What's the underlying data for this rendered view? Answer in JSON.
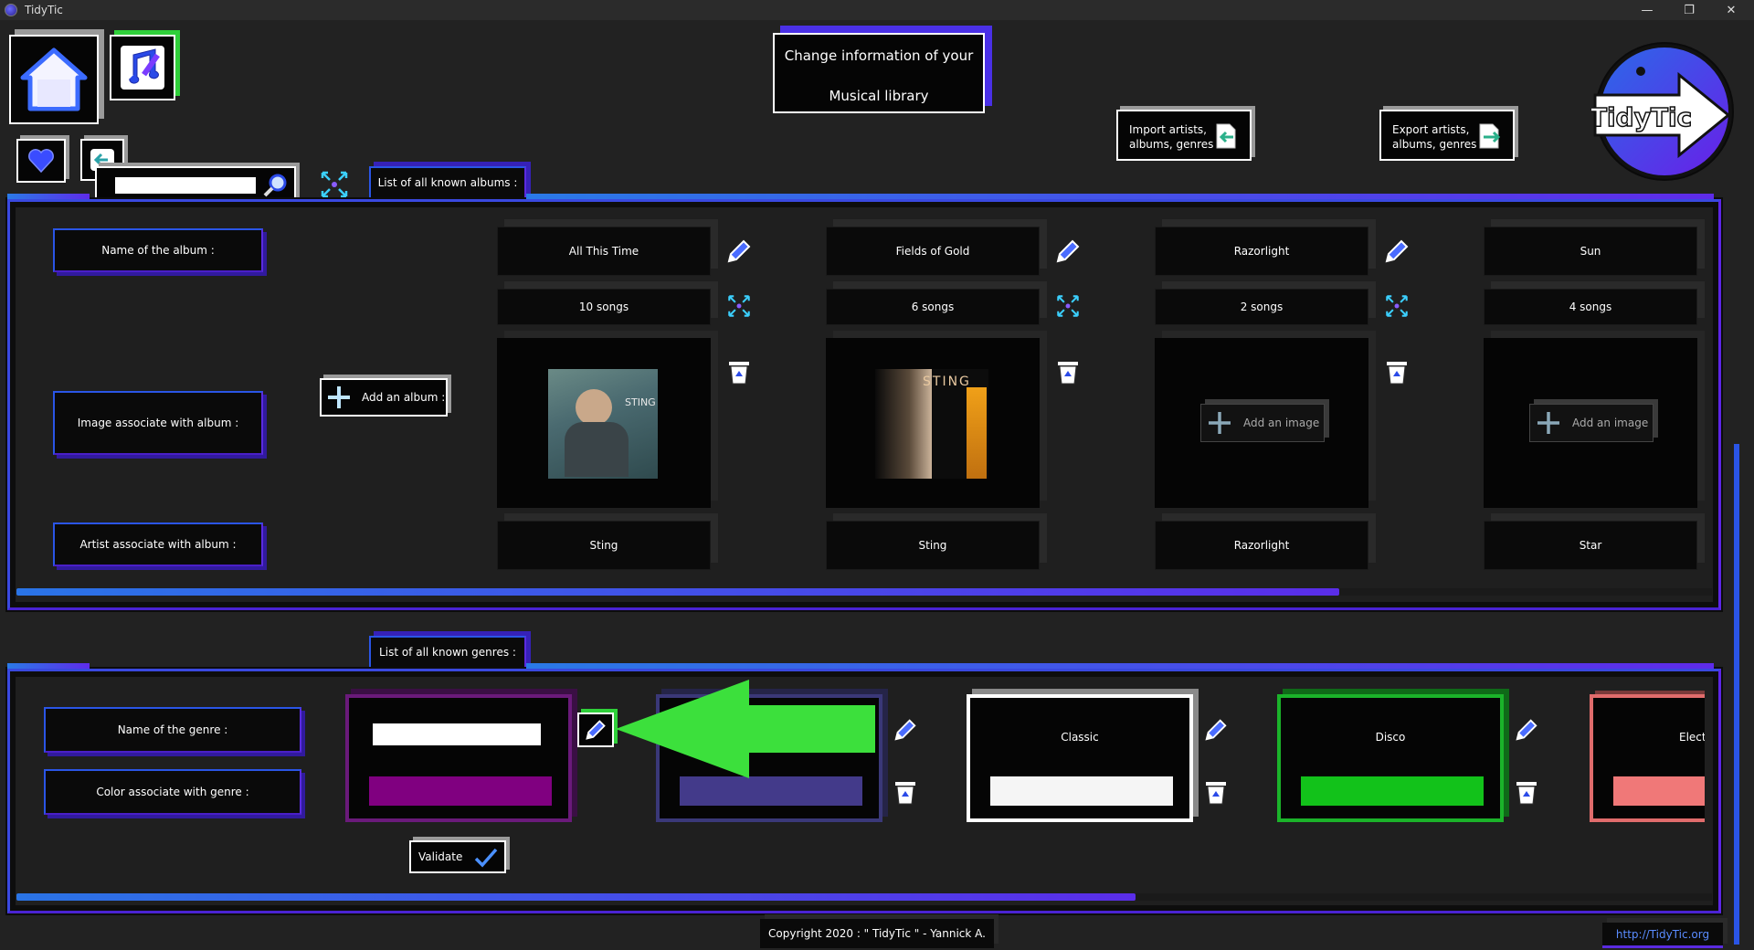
{
  "window": {
    "title": "TidyTic",
    "controls": [
      "—",
      "❐",
      "✕"
    ]
  },
  "header": {
    "title_line1": "Change information of your",
    "title_line2": "Musical library",
    "import_label_line1": "Import artists,",
    "import_label_line2": "albums, genres",
    "export_label_line1": "Export artists,",
    "export_label_line2": "albums, genres",
    "logo_text": "TidyTic",
    "search_value": ""
  },
  "albums_section": {
    "tab_label": "List of all known albums :",
    "row_labels": {
      "name": "Name of the album :",
      "image": "Image associate with album :",
      "artist": "Artist associate with album :"
    },
    "add_album_label": "Add an album :",
    "add_image_label": "Add an image",
    "albums": [
      {
        "name": "All This Time",
        "songs": "10 songs",
        "artist": "Sting",
        "has_image": true,
        "cover_word": "STING"
      },
      {
        "name": "Fields of Gold",
        "songs": "6 songs",
        "artist": "Sting",
        "has_image": true,
        "cover_word": "STING"
      },
      {
        "name": "Razorlight",
        "songs": "2 songs",
        "artist": "Razorlight",
        "has_image": false
      },
      {
        "name": "Sun",
        "songs": "4 songs",
        "artist": "Star",
        "has_image": false
      }
    ],
    "scroll_position": 0.78
  },
  "genres_section": {
    "tab_label": "List of all known genres :",
    "row_labels": {
      "name": "Name of the genre :",
      "color": "Color associate with genre :"
    },
    "validate_label": "Validate",
    "new_genre": {
      "value": "",
      "color": "#800080",
      "border": "#6a1a7a"
    },
    "genres": [
      {
        "name": "",
        "color": "#433a8a",
        "border": "#3a3878"
      },
      {
        "name": "Classic",
        "color": "#f5f5f5",
        "border": "#ffffff"
      },
      {
        "name": "Disco",
        "color": "#12c21a",
        "border": "#1bb32a"
      },
      {
        "name": "Elect",
        "color": "#f07878",
        "border": "#e06c6c"
      }
    ],
    "scroll_position": 0.66
  },
  "footer": {
    "copyright": "Copyright 2020 : \" TidyTic \" - Yannick A.",
    "link": "http://TidyTic.org"
  },
  "colors": {
    "accent_blue": "#2a55e6",
    "accent_purple": "#5a2be0",
    "arrow_green": "#3ce03c"
  }
}
